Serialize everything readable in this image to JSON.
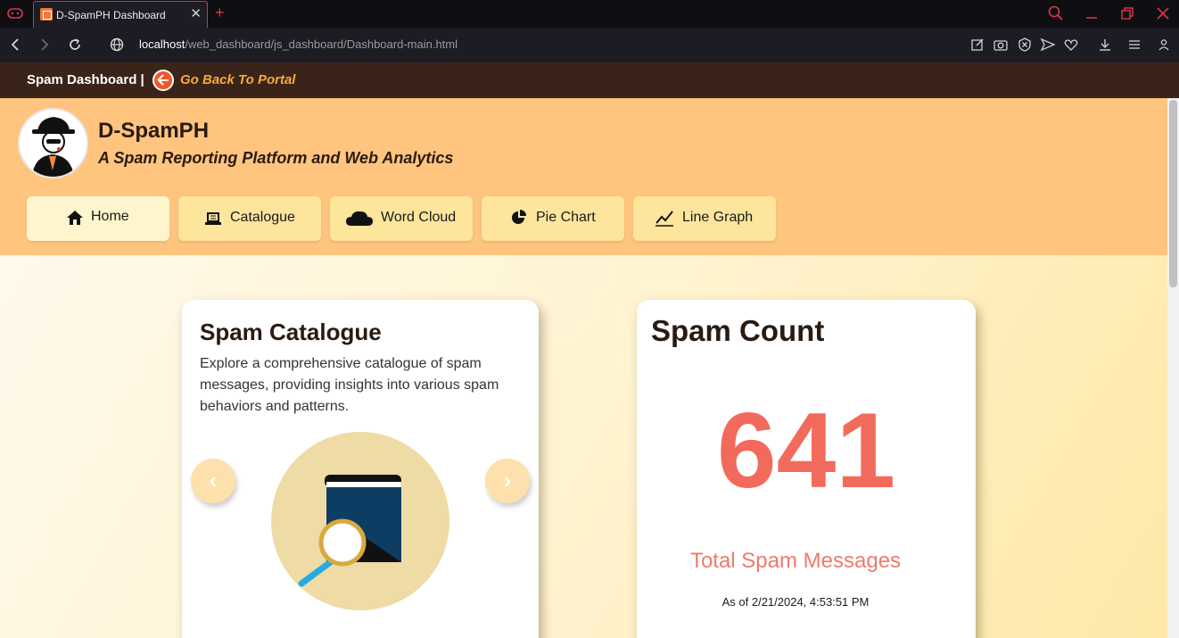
{
  "browser": {
    "tab_title": "D-SpamPH Dashboard",
    "tab_close": "✕",
    "new_tab": "+",
    "url_host": "localhost",
    "url_path": "/web_dashboard/js_dashboard/Dashboard-main.html"
  },
  "topbar": {
    "title": "Spam Dashboard |",
    "back_link": "Go Back To Portal"
  },
  "header": {
    "brand": "D-SpamPH",
    "tagline": "A Spam Reporting Platform and Web Analytics"
  },
  "nav": {
    "items": [
      {
        "label": "Home",
        "icon": "home-icon",
        "active": true
      },
      {
        "label": "Catalogue",
        "icon": "laptop-icon",
        "active": false
      },
      {
        "label": "Word Cloud",
        "icon": "cloud-icon",
        "active": false
      },
      {
        "label": "Pie Chart",
        "icon": "pie-chart-icon",
        "active": false
      },
      {
        "label": "Line Graph",
        "icon": "line-graph-icon",
        "active": false
      }
    ]
  },
  "catalogue_card": {
    "title": "Spam Catalogue",
    "description": "Explore a comprehensive catalogue of spam messages, providing insights into various spam behaviors and patterns.",
    "prev": "‹",
    "next": "›"
  },
  "count_card": {
    "title": "Spam Count",
    "count": "641",
    "label": "Total Spam Messages",
    "as_of": "As of 2/21/2024, 4:53:51 PM"
  },
  "colors": {
    "header_bg": "#ffc47e",
    "topbar_bg": "#3a2419",
    "count": "#f26a5c",
    "nav_button": "#fde59c"
  }
}
